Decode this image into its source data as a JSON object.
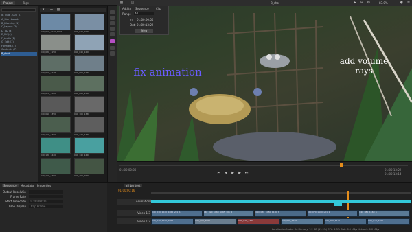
{
  "app": {
    "tabs": [
      "Project",
      "Tags"
    ],
    "title": "B_shot",
    "zoom": "83.0%"
  },
  "project_panel": {
    "root": "JB_bug_1000_01",
    "bins": [
      {
        "label": "A_Storyboards",
        "selected": false
      },
      {
        "label": "B_Blocking (1)",
        "selected": false
      },
      {
        "label": "C_Layout (2)",
        "selected": false
      },
      {
        "label": "D_3D (3)",
        "selected": false
      },
      {
        "label": "E_FX (4)",
        "selected": false
      },
      {
        "label": "F_Audio (1)",
        "selected": false
      },
      {
        "label": "G_Edit (1)",
        "selected": false
      },
      {
        "label": "Formats (1)",
        "selected": false
      },
      {
        "label": "Contents (7)",
        "selected": false
      },
      {
        "label": "B_shot",
        "selected": true
      }
    ]
  },
  "thumbnails": [
    {
      "label": "040_010_1040_1065",
      "color": "#6d8aa6"
    },
    {
      "label": "040_020_1060",
      "color": "#7a8fa4"
    },
    {
      "label": "040_030_1150",
      "color": "#8a8f8a"
    },
    {
      "label": "040_040_1200",
      "color": "#8fa3b5"
    },
    {
      "label": "040_050_1248",
      "color": "#5e6e66"
    },
    {
      "label": "040_060_1270",
      "color": "#6f7f8a"
    },
    {
      "label": "040_070_1300",
      "color": "#4a5a4a"
    },
    {
      "label": "040_080_1320",
      "color": "#5d7060"
    },
    {
      "label": "040_090_1350",
      "color": "#595959"
    },
    {
      "label": "040_100_1380",
      "color": "#696969"
    },
    {
      "label": "040_110_1400",
      "color": "#4b5e4e"
    },
    {
      "label": "040_120_1420",
      "color": "#5e5e5e"
    },
    {
      "label": "040_130_1440",
      "color": "#3f8f86"
    },
    {
      "label": "040_140_1460",
      "color": "#49a0a0"
    },
    {
      "label": "040_150_1480",
      "color": "#3f5a4a"
    },
    {
      "label": "040_160_1500",
      "color": "#445544"
    }
  ],
  "popup": {
    "add_to": "Add to",
    "dest": "Sequence",
    "clip": "Clip",
    "range_label": "Range",
    "range_value": "All",
    "in_label": "In:",
    "in_value": "01:00:00:00",
    "out_label": "Out:",
    "out_value": "01:00:13:22",
    "button": "New"
  },
  "viewer": {
    "annotations": [
      {
        "text": "fix animation",
        "color": "#6a5cff"
      },
      {
        "text": "add volume rays",
        "color": "#ffffff"
      }
    ],
    "timecode_left": "01:00:00:00",
    "timecode_right": "01:00:13:22",
    "duration": "01:00:13:14"
  },
  "inspector": {
    "tabs": [
      "Sequence",
      "Metadata",
      "Properties"
    ],
    "fields": [
      {
        "label": "Output Resolution",
        "value": ""
      },
      {
        "label": "Frame Rate",
        "value": ""
      },
      {
        "label": "Start Timecode",
        "value": "01:00:00:00"
      },
      {
        "label": "Time Display",
        "value": "Drop Frame"
      }
    ]
  },
  "timeline": {
    "sequence_tab": "all_bg_test",
    "timecode": "01:00:00:16",
    "tracks": [
      {
        "name": "Animations"
      },
      {
        "name": "Video 1.3"
      },
      {
        "name": "Video 1.2"
      }
    ],
    "clips_v13": [
      "040_010_1040_1065_v01_1",
      "040_020_1060_1065_v01_2",
      "040_030_1080_1100_t",
      "040_070_1100_v01_1",
      "040_080_1160_1"
    ],
    "clips_v12": [
      "040_010_1040_1065",
      "040_020_1060",
      "040_030_1150",
      "040_050_1248",
      "040_060_1270",
      "040_070_1300"
    ],
    "status": "Localisation Mode: On  Memory: 7.2 GB (11.9%)  CPU: 2.3%  Disk: 0.0 MB/s  Network: 0.0 MB/s"
  }
}
